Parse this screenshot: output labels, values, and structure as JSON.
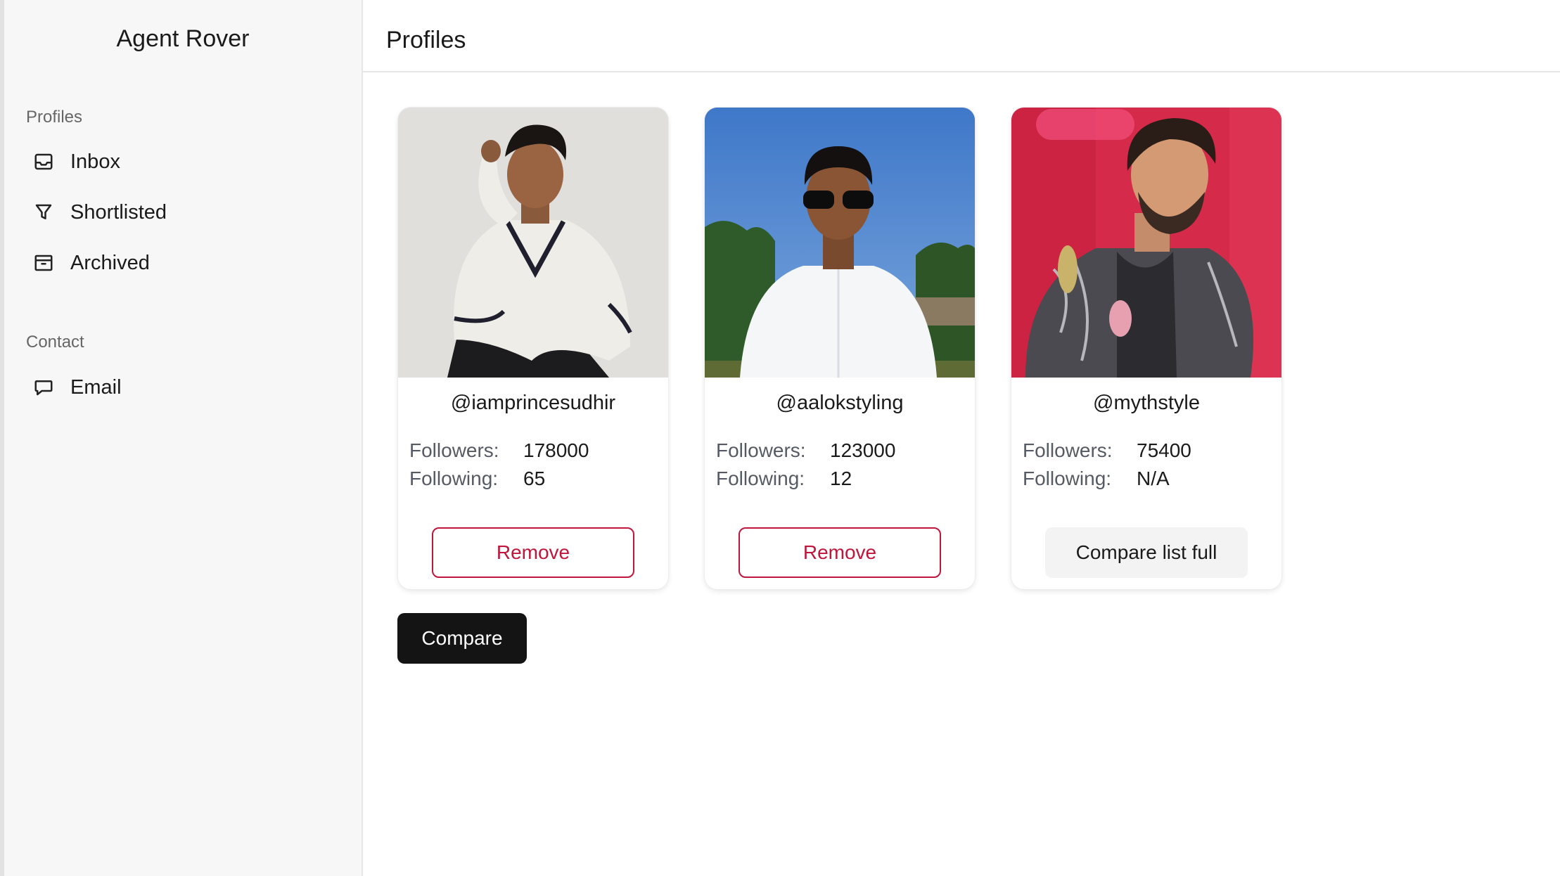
{
  "app": {
    "title": "Agent Rover"
  },
  "header": {
    "title": "Profiles"
  },
  "sidebar": {
    "sections": [
      {
        "label": "Profiles",
        "items": [
          {
            "label": "Inbox",
            "icon": "inbox-icon"
          },
          {
            "label": "Shortlisted",
            "icon": "filter-icon"
          },
          {
            "label": "Archived",
            "icon": "archive-icon"
          }
        ]
      },
      {
        "label": "Contact",
        "items": [
          {
            "label": "Email",
            "icon": "chat-bubble-icon"
          }
        ]
      }
    ]
  },
  "stats_labels": {
    "followers": "Followers:",
    "following": "Following:"
  },
  "profiles": [
    {
      "handle": "@iamprincesudhir",
      "followers": "178000",
      "following": "65",
      "action": "Remove",
      "action_state": "remove",
      "photo_bg": "#dcdad8"
    },
    {
      "handle": "@aalokstyling",
      "followers": "123000",
      "following": "12",
      "action": "Remove",
      "action_state": "remove",
      "photo_bg": "#4a7fc8"
    },
    {
      "handle": "@mythstyle",
      "followers": "75400",
      "following": "N/A",
      "action": "Compare list full",
      "action_state": "disabled",
      "photo_bg": "#d62a4a"
    }
  ],
  "actions": {
    "compare_label": "Compare"
  },
  "colors": {
    "remove_accent": "#c0163c",
    "primary_button": "#141414"
  }
}
